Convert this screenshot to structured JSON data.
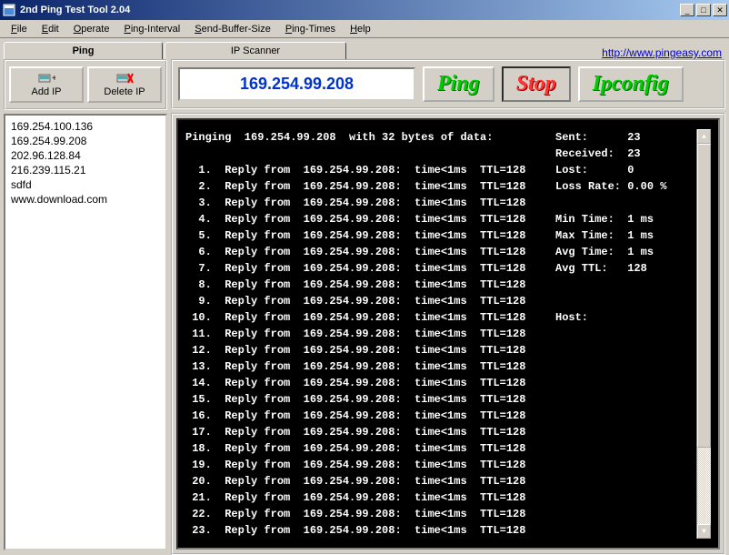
{
  "window": {
    "title": "2nd Ping Test Tool 2.04"
  },
  "menu": [
    "File",
    "Edit",
    "Operate",
    "Ping-Interval",
    "Send-Buffer-Size",
    "Ping-Times",
    "Help"
  ],
  "tabs": {
    "active": "Ping",
    "items": [
      "Ping",
      "IP Scanner"
    ]
  },
  "link": {
    "label": "http://www.pingeasy.com"
  },
  "buttons": {
    "add": "Add IP",
    "delete": "Delete IP",
    "ping": "Ping",
    "stop": "Stop",
    "ipconfig": "Ipconfig"
  },
  "ip_input": "169.254.99.208",
  "ip_list": [
    "169.254.100.136",
    "169.254.99.208",
    "202.96.128.84",
    "216.239.115.21",
    "sdfd",
    "www.download.com"
  ],
  "ping": {
    "header": "Pinging  169.254.99.208  with 32 bytes of data:",
    "target": "169.254.99.208",
    "time": "<1ms",
    "ttl": "128",
    "count": 23
  },
  "stats": {
    "sent_label": "Sent:",
    "sent": "23",
    "recv_label": "Received:",
    "recv": "23",
    "lost_label": "Lost:",
    "lost": "0",
    "rate_label": "Loss Rate:",
    "rate": "0.00 %",
    "min_label": "Min Time:",
    "min": "1 ms",
    "max_label": "Max Time:",
    "max": "1 ms",
    "avg_label": "Avg Time:",
    "avg": "1 ms",
    "attl_label": "Avg TTL:",
    "attl": "128",
    "host_label": "Host:",
    "host": ""
  }
}
